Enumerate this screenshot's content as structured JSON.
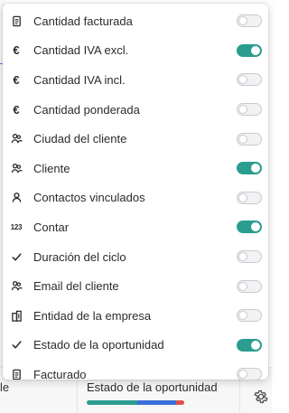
{
  "background": {
    "left_fragment_text": "le",
    "column_title": "Estado de la oportunidad",
    "progress_colors": [
      "#2a9d8f",
      "#2a9d8f",
      "#3b6fd8",
      "#e0514b"
    ],
    "progress_segments": [
      0.52,
      0.0,
      0.4,
      0.08
    ]
  },
  "accent_color": "#2a9d8f",
  "menu": {
    "items": [
      {
        "icon": "invoice-icon",
        "label": "Cantidad facturada",
        "enabled": false
      },
      {
        "icon": "euro-icon",
        "label": "Cantidad IVA excl.",
        "enabled": true
      },
      {
        "icon": "euro-icon",
        "label": "Cantidad IVA incl.",
        "enabled": false
      },
      {
        "icon": "euro-icon",
        "label": "Cantidad ponderada",
        "enabled": false
      },
      {
        "icon": "contacts-icon",
        "label": "Ciudad del cliente",
        "enabled": false
      },
      {
        "icon": "contacts-icon",
        "label": "Cliente",
        "enabled": true
      },
      {
        "icon": "person-icon",
        "label": "Contactos vinculados",
        "enabled": false
      },
      {
        "icon": "number-icon",
        "label": "Contar",
        "enabled": true
      },
      {
        "icon": "check-icon",
        "label": "Duración del ciclo",
        "enabled": false
      },
      {
        "icon": "contacts-icon",
        "label": "Email del cliente",
        "enabled": false
      },
      {
        "icon": "building-icon",
        "label": "Entidad de la empresa",
        "enabled": false
      },
      {
        "icon": "check-icon",
        "label": "Estado de la oportunidad",
        "enabled": true
      },
      {
        "icon": "invoice-icon",
        "label": "Facturado",
        "enabled": false
      }
    ]
  }
}
